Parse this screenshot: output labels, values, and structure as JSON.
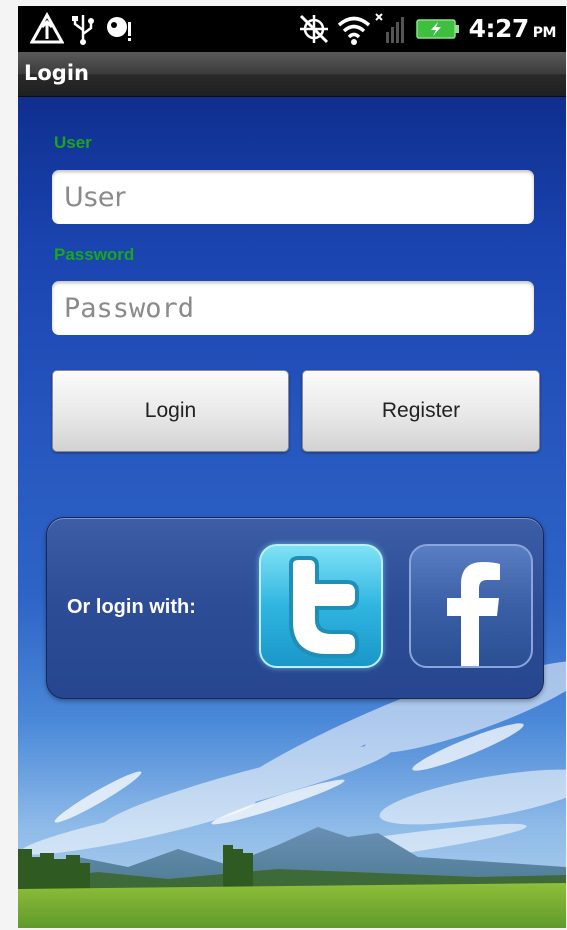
{
  "status_bar": {
    "time": "4:27",
    "ampm": "PM",
    "icons": [
      "alert-triangle-icon",
      "usb-icon",
      "notification-icon",
      "gps-off-icon",
      "wifi-icon",
      "signal-icon",
      "battery-icon"
    ],
    "battery_color": "#3fbf3f"
  },
  "title_bar": {
    "title": "Login"
  },
  "form": {
    "user_label": "User",
    "user_placeholder": "User",
    "password_label": "Password",
    "password_placeholder": "Password",
    "label_color": "#1aa51a"
  },
  "buttons": {
    "login_label": "Login",
    "register_label": "Register"
  },
  "social": {
    "label": "Or login with:",
    "providers": [
      "twitter-icon",
      "facebook-icon"
    ],
    "twitter_color": "#2fb5e0",
    "facebook_color": "#3a5fa6"
  }
}
